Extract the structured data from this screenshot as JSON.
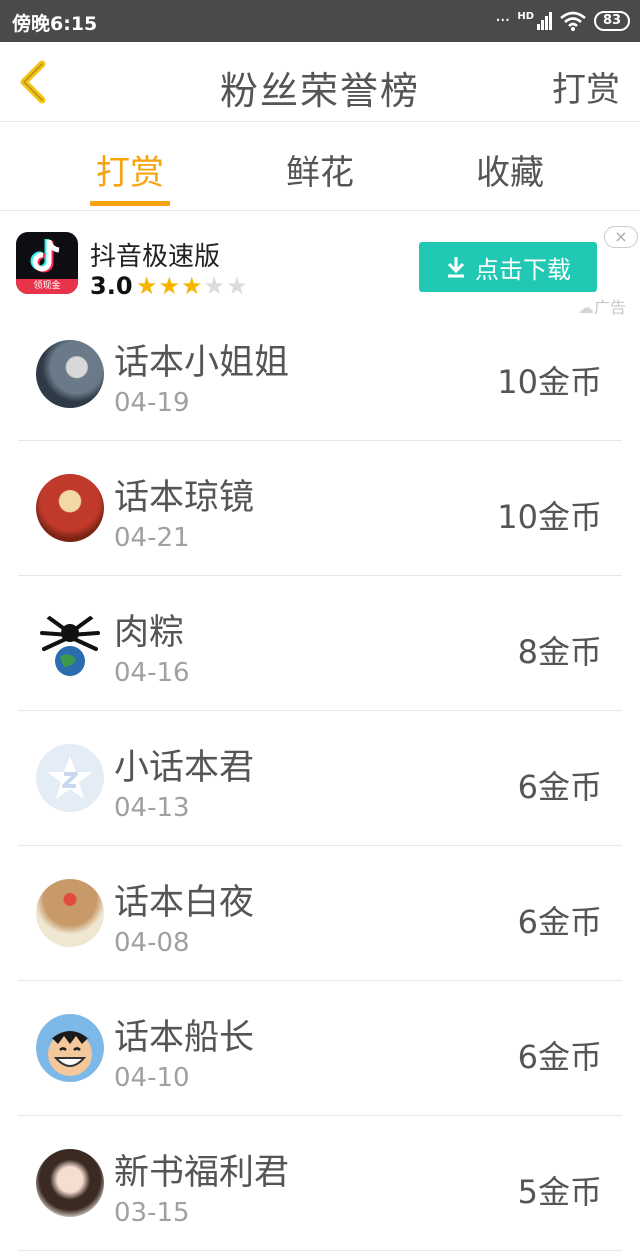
{
  "status_bar": {
    "time": "傍晚6:15",
    "network": "HD",
    "battery": "83"
  },
  "header": {
    "title": "粉丝荣誉榜",
    "action_label": "打赏"
  },
  "tabs": [
    {
      "label": "打赏",
      "active": true
    },
    {
      "label": "鲜花",
      "active": false
    },
    {
      "label": "收藏",
      "active": false
    }
  ],
  "ad": {
    "app_name": "抖音极速版",
    "icon_badge": "领现金",
    "rating": "3.0",
    "stars_filled": 3,
    "stars_total": 5,
    "download_label": "点击下载",
    "close_symbol": "×",
    "tag": "广告"
  },
  "fans": [
    {
      "name": "话本小姐姐",
      "date": "04-19",
      "amount": "10金币",
      "avatar_icon": "photo-avatar"
    },
    {
      "name": "话本琼镜",
      "date": "04-21",
      "amount": "10金币",
      "avatar_icon": "costume-avatar"
    },
    {
      "name": "肉粽",
      "date": "04-16",
      "amount": "8金币",
      "avatar_icon": "cartoon-globe-avatar"
    },
    {
      "name": "小话本君",
      "date": "04-13",
      "amount": "6金币",
      "avatar_icon": "default-avatar"
    },
    {
      "name": "话本白夜",
      "date": "04-08",
      "amount": "6金币",
      "avatar_icon": "girl-avatar"
    },
    {
      "name": "话本船长",
      "date": "04-10",
      "amount": "6金币",
      "avatar_icon": "pirate-avatar"
    },
    {
      "name": "新书福利君",
      "date": "03-15",
      "amount": "5金币",
      "avatar_icon": "girl-photo-avatar"
    }
  ],
  "colors": {
    "accent": "#f5a30f",
    "download_button": "#21c8b4",
    "status_bar": "#4a4a4a",
    "star": "#f7b500"
  }
}
